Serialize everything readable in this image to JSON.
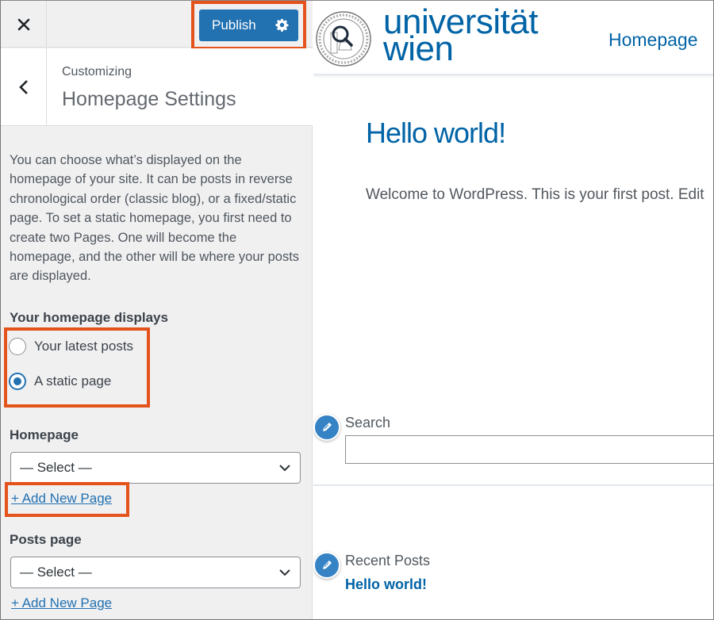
{
  "topbar": {
    "close_icon": "close-icon",
    "publish_label": "Publish",
    "settings_icon": "gear-icon"
  },
  "section": {
    "back_icon": "chevron-left-icon",
    "breadcrumb": "Customizing",
    "title": "Homepage Settings"
  },
  "description": "You can choose what’s displayed on the homepage of your site. It can be posts in reverse chronological order (classic blog), or a fixed/static page. To set a static homepage, you first need to create two Pages. One will become the homepage, and the other will be where your posts are displayed.",
  "homepage_displays": {
    "label": "Your homepage displays",
    "options": [
      {
        "label": "Your latest posts",
        "checked": false
      },
      {
        "label": "A static page",
        "checked": true
      }
    ]
  },
  "homepage": {
    "label": "Homepage",
    "selected": "— Select —",
    "add_link": "+ Add New Page"
  },
  "posts_page": {
    "label": "Posts page",
    "selected": "— Select —",
    "add_link": "+ Add New Page"
  },
  "preview": {
    "logo_line1": "universität",
    "logo_line2": "wien",
    "nav_item": "Homepage",
    "post_title": "Hello world!",
    "post_excerpt": "Welcome to WordPress. This is your first post. Edit",
    "search_widget_title": "Search",
    "search_value": "",
    "recent_posts_title": "Recent Posts",
    "recent_posts": [
      "Hello world!"
    ]
  },
  "colors": {
    "accent": "#2271b1",
    "highlight": "#e4531b",
    "brand": "#0063a6"
  }
}
